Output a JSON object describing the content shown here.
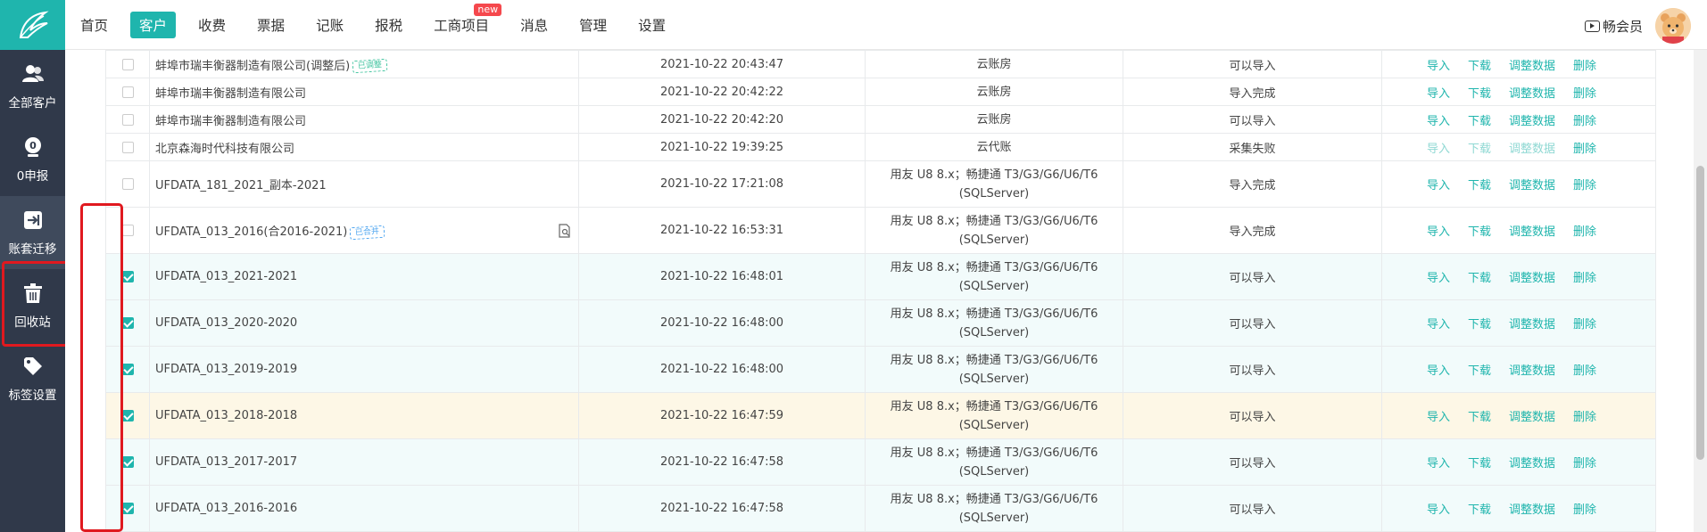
{
  "nav": {
    "items": [
      {
        "label": "首页"
      },
      {
        "label": "客户",
        "active": true
      },
      {
        "label": "收费"
      },
      {
        "label": "票据"
      },
      {
        "label": "记账"
      },
      {
        "label": "报税"
      },
      {
        "label": "工商项目",
        "badge": "new"
      },
      {
        "label": "消息"
      },
      {
        "label": "管理"
      },
      {
        "label": "设置"
      }
    ],
    "member_label": "畅会员"
  },
  "sidebar": {
    "items": [
      {
        "label": "全部客户",
        "icon": "users-icon"
      },
      {
        "label": "0申报",
        "icon": "zero-declare-icon"
      },
      {
        "label": "账套迁移",
        "icon": "migrate-icon",
        "active": true
      },
      {
        "label": "回收站",
        "icon": "trash-icon"
      },
      {
        "label": "标签设置",
        "icon": "tag-icon"
      }
    ]
  },
  "table": {
    "ops": [
      "导入",
      "下载",
      "调整数据",
      "删除"
    ],
    "rows": [
      {
        "name": "蚌埠市瑞丰衡器制造有限公司(调整后)",
        "stamp": "已调整",
        "time": "2021-10-22 20:43:47",
        "type": "云账房",
        "status": "可以导入",
        "checked": false
      },
      {
        "name": "蚌埠市瑞丰衡器制造有限公司",
        "time": "2021-10-22 20:42:22",
        "type": "云账房",
        "status": "导入完成",
        "checked": false
      },
      {
        "name": "蚌埠市瑞丰衡器制造有限公司",
        "time": "2021-10-22 20:42:20",
        "type": "云账房",
        "status": "可以导入",
        "checked": false
      },
      {
        "name": "北京森海时代科技有限公司",
        "time": "2021-10-22 19:39:25",
        "type": "云代账",
        "status": "采集失败",
        "checked": false,
        "ops_disabled": true
      },
      {
        "name": "UFDATA_181_2021_副本-2021",
        "time": "2021-10-22 17:21:08",
        "type": "用友 U8 8.x；畅捷通 T3/G3/G6/U6/T6 (SQLServer)",
        "status": "导入完成",
        "checked": false
      },
      {
        "name": "UFDATA_013_2016(合2016-2021)",
        "stamp": "已合并",
        "time": "2021-10-22 16:53:31",
        "type": "用友 U8 8.x；畅捷通 T3/G3/G6/U6/T6 (SQLServer)",
        "status": "导入完成",
        "checked": false,
        "doc_icon": true
      },
      {
        "name": "UFDATA_013_2021-2021",
        "time": "2021-10-22 16:48:01",
        "type": "用友 U8 8.x；畅捷通 T3/G3/G6/U6/T6 (SQLServer)",
        "status": "可以导入",
        "checked": true
      },
      {
        "name": "UFDATA_013_2020-2020",
        "time": "2021-10-22 16:48:00",
        "type": "用友 U8 8.x；畅捷通 T3/G3/G6/U6/T6 (SQLServer)",
        "status": "可以导入",
        "checked": true
      },
      {
        "name": "UFDATA_013_2019-2019",
        "time": "2021-10-22 16:48:00",
        "type": "用友 U8 8.x；畅捷通 T3/G3/G6/U6/T6 (SQLServer)",
        "status": "可以导入",
        "checked": true
      },
      {
        "name": "UFDATA_013_2018-2018",
        "time": "2021-10-22 16:47:59",
        "type": "用友 U8 8.x；畅捷通 T3/G3/G6/U6/T6 (SQLServer)",
        "status": "可以导入",
        "checked": true,
        "hover": true
      },
      {
        "name": "UFDATA_013_2017-2017",
        "time": "2021-10-22 16:47:58",
        "type": "用友 U8 8.x；畅捷通 T3/G3/G6/U6/T6 (SQLServer)",
        "status": "可以导入",
        "checked": true
      },
      {
        "name": "UFDATA_013_2016-2016",
        "time": "2021-10-22 16:47:58",
        "type": "用友 U8 8.x；畅捷通 T3/G3/G6/U6/T6 (SQLServer)",
        "status": "可以导入",
        "checked": true
      }
    ]
  },
  "colors": {
    "accent": "#1fb5ad",
    "sidebar": "#30394a",
    "highlight": "#e0191f"
  }
}
